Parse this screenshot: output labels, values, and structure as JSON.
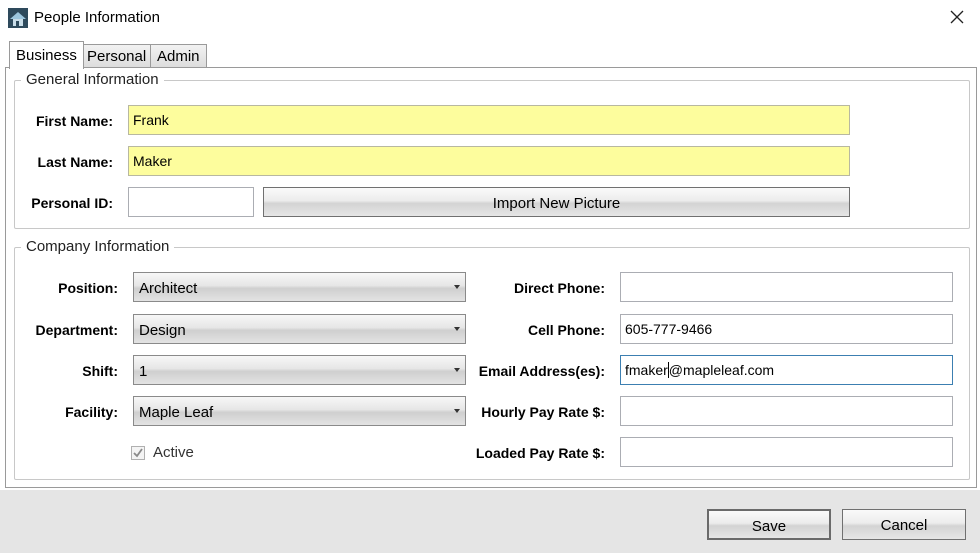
{
  "window": {
    "title": "People Information",
    "icon": "house-icon",
    "close_icon": "close-icon"
  },
  "tabs": [
    {
      "label": "Business",
      "active": true
    },
    {
      "label": "Personal",
      "active": false
    },
    {
      "label": "Admin",
      "active": false
    }
  ],
  "general": {
    "legend": "General Information",
    "first_name": {
      "label": "First Name:",
      "value": "Frank"
    },
    "last_name": {
      "label": "Last Name:",
      "value": "Maker"
    },
    "personal_id": {
      "label": "Personal ID:",
      "value": ""
    },
    "import_button": "Import New Picture",
    "required_color": "#fdfd9d"
  },
  "company": {
    "legend": "Company Information",
    "position": {
      "label": "Position:",
      "value": "Architect"
    },
    "department": {
      "label": "Department:",
      "value": "Design"
    },
    "shift": {
      "label": "Shift:",
      "value": "1"
    },
    "facility": {
      "label": "Facility:",
      "value": "Maple Leaf"
    },
    "active": {
      "label": "Active",
      "checked": true
    },
    "direct_phone": {
      "label": "Direct Phone:",
      "value": ""
    },
    "cell_phone": {
      "label": "Cell Phone:",
      "value": "605-777-9466"
    },
    "email": {
      "label": "Email Address(es):",
      "value_before_caret": "fmaker",
      "value_after_caret": "@mapleleaf.com"
    },
    "hourly_rate": {
      "label": "Hourly Pay Rate $:",
      "value": ""
    },
    "loaded_rate": {
      "label": "Loaded Pay Rate $:",
      "value": ""
    }
  },
  "footer": {
    "save": "Save",
    "cancel": "Cancel"
  }
}
